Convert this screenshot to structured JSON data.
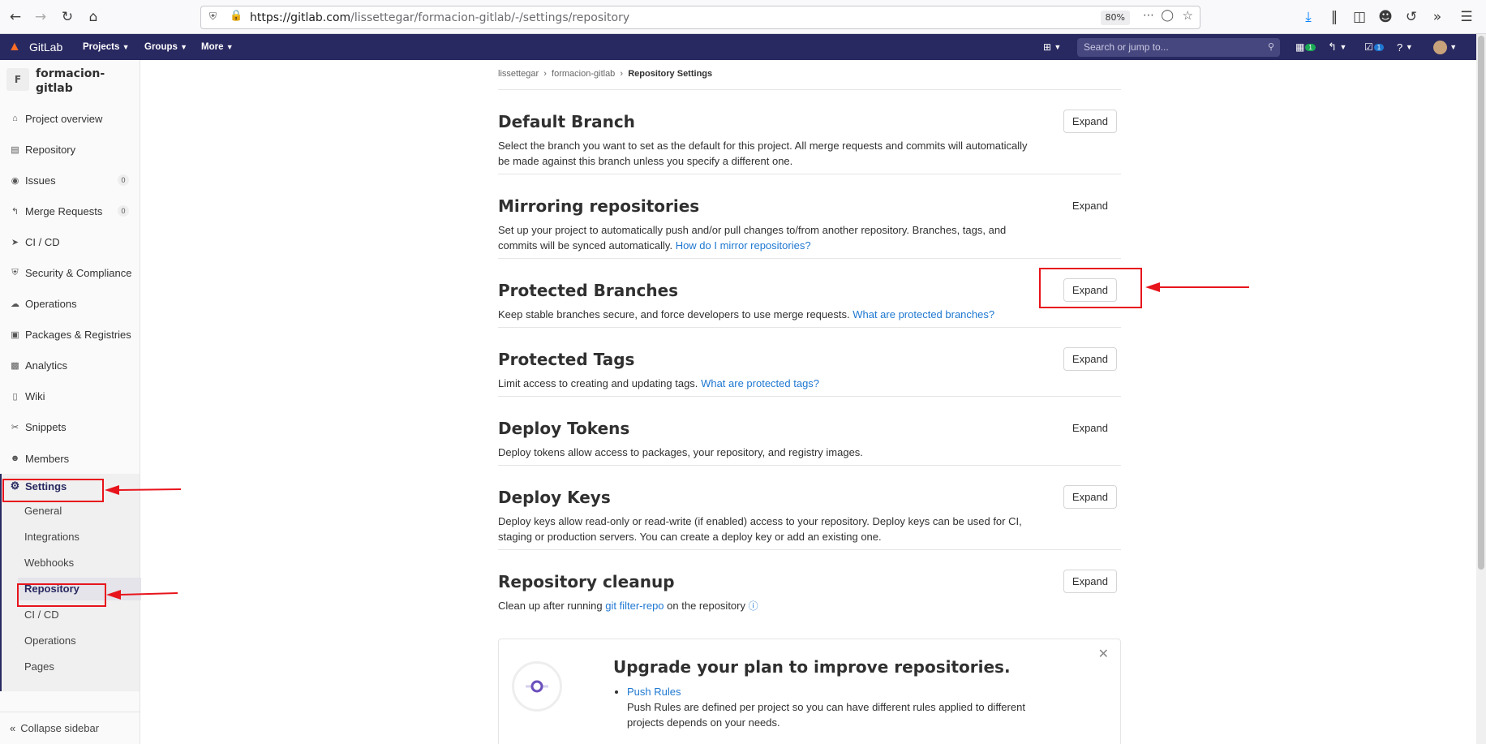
{
  "browser": {
    "url_domain": "https://gitlab.com",
    "url_path": "/lissettegar/formacion-gitlab/-/settings/repository",
    "zoom": "80%"
  },
  "navbar": {
    "brand": "GitLab",
    "menus": [
      "Projects",
      "Groups",
      "More"
    ],
    "search_placeholder": "Search or jump to...",
    "mr_count": "1",
    "todo_count": "1"
  },
  "sidebar": {
    "project_initial": "F",
    "project_name": "formacion-gitlab",
    "items": [
      {
        "label": "Project overview",
        "icon": "home-icon"
      },
      {
        "label": "Repository",
        "icon": "doc-icon"
      },
      {
        "label": "Issues",
        "icon": "issues-icon",
        "count": "0"
      },
      {
        "label": "Merge Requests",
        "icon": "merge-icon",
        "count": "0"
      },
      {
        "label": "CI / CD",
        "icon": "rocket-icon"
      },
      {
        "label": "Security & Compliance",
        "icon": "shield-icon"
      },
      {
        "label": "Operations",
        "icon": "cloud-icon"
      },
      {
        "label": "Packages & Registries",
        "icon": "package-icon"
      },
      {
        "label": "Analytics",
        "icon": "chart-icon"
      },
      {
        "label": "Wiki",
        "icon": "book-icon"
      },
      {
        "label": "Snippets",
        "icon": "scissors-icon"
      },
      {
        "label": "Members",
        "icon": "users-icon"
      }
    ],
    "settings_label": "Settings",
    "settings_sub": [
      "General",
      "Integrations",
      "Webhooks",
      "Repository",
      "CI / CD",
      "Operations",
      "Pages"
    ],
    "collapse_label": "Collapse sidebar"
  },
  "breadcrumb": {
    "user": "lissettegar",
    "project": "formacion-gitlab",
    "current": "Repository Settings"
  },
  "sections": [
    {
      "title": "Default Branch",
      "desc": "Select the branch you want to set as the default for this project. All merge requests and commits will automatically be made against this branch unless you specify a different one.",
      "link": "",
      "button": "Expand"
    },
    {
      "title": "Mirroring repositories",
      "desc": "Set up your project to automatically push and/or pull changes to/from another repository. Branches, tags, and commits will be synced automatically.",
      "link": "How do I mirror repositories?",
      "button": "Expand"
    },
    {
      "title": "Protected Branches",
      "desc": "Keep stable branches secure, and force developers to use merge requests.",
      "link": "What are protected branches?",
      "button": "Expand"
    },
    {
      "title": "Protected Tags",
      "desc": "Limit access to creating and updating tags.",
      "link": "What are protected tags?",
      "button": "Expand"
    },
    {
      "title": "Deploy Tokens",
      "desc": "Deploy tokens allow access to packages, your repository, and registry images.",
      "link": "",
      "button": "Expand"
    },
    {
      "title": "Deploy Keys",
      "desc": "Deploy keys allow read-only or read-write (if enabled) access to your repository. Deploy keys can be used for CI, staging or production servers. You can create a deploy key or add an existing one.",
      "link": "",
      "button": "Expand"
    },
    {
      "title": "Repository cleanup",
      "desc_before": "Clean up after running",
      "link": "git filter-repo",
      "desc_after": "on the repository",
      "button": "Expand"
    }
  ],
  "promo": {
    "title": "Upgrade your plan to improve repositories.",
    "item_link": "Push Rules",
    "item_desc": "Push Rules are defined per project so you can have different rules applied to different projects depends on your needs."
  },
  "colors": {
    "navbar": "#292961",
    "link": "#1f78d1",
    "annotation": "#e8141c"
  }
}
